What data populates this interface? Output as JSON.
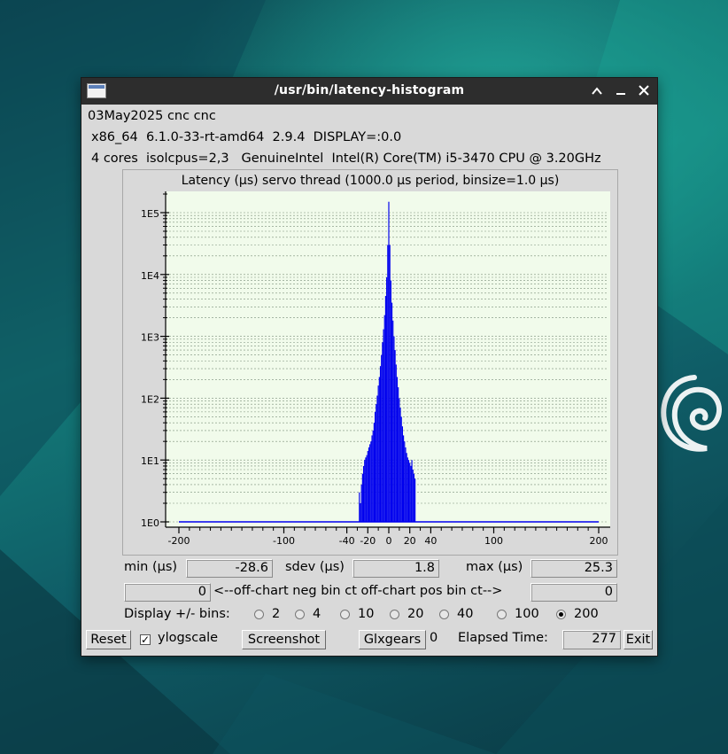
{
  "window": {
    "title": "/usr/bin/latency-histogram",
    "controls": {
      "minimize": "▲",
      "maximize": "▬",
      "close": "✕"
    }
  },
  "info": {
    "line1": "03May2025 cnc cnc",
    "line2": "x86_64  6.1.0-33-rt-amd64  2.9.4  DISPLAY=:0.0",
    "line3": "4 cores  isolcpus=2,3   GenuineIntel  Intel(R) Core(TM) i5-3470 CPU @ 3.20GHz"
  },
  "chart_data": {
    "type": "bar",
    "title": "Latency (μs) servo thread (1000.0 μs period, binsize=1.0 μs)",
    "xlabel": "",
    "ylabel": "",
    "xlim": [
      -200,
      200
    ],
    "xticks": [
      -200,
      -100,
      -40,
      -20,
      0,
      20,
      40,
      100,
      200
    ],
    "yscale": "log",
    "ylim": [
      1,
      160000
    ],
    "yticks": [
      1,
      10,
      100,
      1000,
      10000,
      100000
    ],
    "ytick_labels": [
      "1E0",
      "1E1",
      "1E2",
      "1E3",
      "1E4",
      "1E5"
    ],
    "grid": true,
    "background": "#f1fbeb",
    "bar_color": "#0000ee",
    "bins": [
      {
        "x": -28,
        "y": 3
      },
      {
        "x": -27,
        "y": 2
      },
      {
        "x": -26,
        "y": 4
      },
      {
        "x": -25,
        "y": 6
      },
      {
        "x": -24,
        "y": 8
      },
      {
        "x": -23,
        "y": 10
      },
      {
        "x": -22,
        "y": 11
      },
      {
        "x": -21,
        "y": 12
      },
      {
        "x": -20,
        "y": 14
      },
      {
        "x": -19,
        "y": 16
      },
      {
        "x": -18,
        "y": 18
      },
      {
        "x": -17,
        "y": 20
      },
      {
        "x": -16,
        "y": 25
      },
      {
        "x": -15,
        "y": 30
      },
      {
        "x": -14,
        "y": 40
      },
      {
        "x": -13,
        "y": 60
      },
      {
        "x": -12,
        "y": 80
      },
      {
        "x": -11,
        "y": 110
      },
      {
        "x": -10,
        "y": 160
      },
      {
        "x": -9,
        "y": 220
      },
      {
        "x": -8,
        "y": 330
      },
      {
        "x": -7,
        "y": 500
      },
      {
        "x": -6,
        "y": 800
      },
      {
        "x": -5,
        "y": 1300
      },
      {
        "x": -4,
        "y": 2200
      },
      {
        "x": -3,
        "y": 4500
      },
      {
        "x": -2,
        "y": 9000
      },
      {
        "x": -1,
        "y": 30000
      },
      {
        "x": 0,
        "y": 150000
      },
      {
        "x": 1,
        "y": 30000
      },
      {
        "x": 2,
        "y": 8000
      },
      {
        "x": 3,
        "y": 3500
      },
      {
        "x": 4,
        "y": 1800
      },
      {
        "x": 5,
        "y": 1000
      },
      {
        "x": 6,
        "y": 600
      },
      {
        "x": 7,
        "y": 350
      },
      {
        "x": 8,
        "y": 220
      },
      {
        "x": 9,
        "y": 150
      },
      {
        "x": 10,
        "y": 100
      },
      {
        "x": 11,
        "y": 70
      },
      {
        "x": 12,
        "y": 50
      },
      {
        "x": 13,
        "y": 35
      },
      {
        "x": 14,
        "y": 25
      },
      {
        "x": 15,
        "y": 20
      },
      {
        "x": 16,
        "y": 16
      },
      {
        "x": 17,
        "y": 13
      },
      {
        "x": 18,
        "y": 11
      },
      {
        "x": 19,
        "y": 10
      },
      {
        "x": 20,
        "y": 9
      },
      {
        "x": 21,
        "y": 8
      },
      {
        "x": 22,
        "y": 10
      },
      {
        "x": 23,
        "y": 7
      },
      {
        "x": 24,
        "y": 6
      },
      {
        "x": 25,
        "y": 5
      }
    ]
  },
  "stats": {
    "min_label": "min (μs)",
    "min_value": "-28.6",
    "sdev_label": "sdev (μs)",
    "sdev_value": "1.8",
    "max_label": "max (μs)",
    "max_value": "25.3"
  },
  "offchart": {
    "neg_value": "0",
    "label": "<--off-chart neg bin ct off-chart pos bin ct-->",
    "pos_value": "0"
  },
  "bins_selector": {
    "label": "Display +/- bins:",
    "options": [
      "2",
      "4",
      "10",
      "20",
      "40",
      "100",
      "200"
    ],
    "selected": "200"
  },
  "toolbar": {
    "reset": "Reset",
    "ylogscale": "ylogscale",
    "ylogscale_checked": true,
    "check_mark": "✓",
    "screenshot": "Screenshot",
    "glxgears": "Glxgears",
    "glxgears_count": "0",
    "elapsed_label": "Elapsed Time:",
    "elapsed_value": "277",
    "exit": "Exit"
  }
}
